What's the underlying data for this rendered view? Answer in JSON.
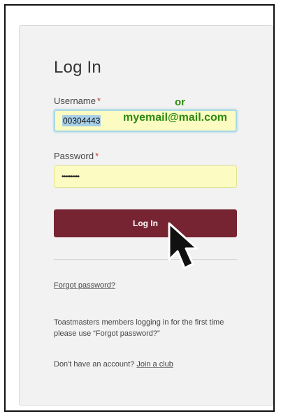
{
  "login": {
    "title": "Log In",
    "username_label": "Username",
    "username_value": "00304443",
    "password_label": "Password",
    "password_value": "••••••••••",
    "required_marker": "*",
    "login_button": "Log In",
    "forgot_password_link": "Forgot password?",
    "first_time_note": "Toastmasters members logging in for the first time please use “Forgot password?”",
    "no_account_text": "Don't have an account?",
    "join_link": "Join a club"
  },
  "annotation": {
    "or_text": "or",
    "email_example": "myemail@mail.com",
    "color": "#2e8b0f"
  },
  "colors": {
    "button_bg": "#772432",
    "field_bg": "#fbfbc2",
    "required": "#c0392b"
  },
  "icons": {
    "cursor": "mouse-pointer-icon"
  }
}
